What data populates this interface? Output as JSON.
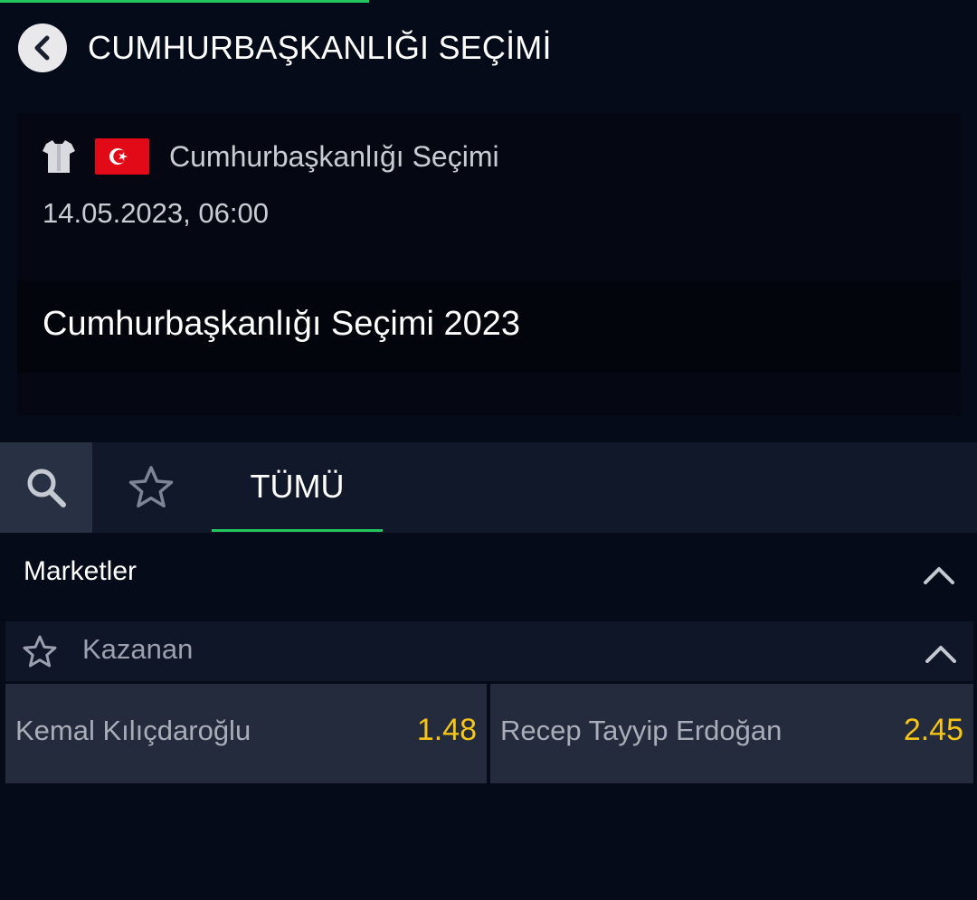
{
  "colors": {
    "accent_green": "#22c55e",
    "odds_yellow": "#f5c518",
    "flag_red": "#e30a17"
  },
  "header": {
    "title": "CUMHURBAŞKANLIĞI SEÇİMİ",
    "back_icon": "chevron-left-icon"
  },
  "event": {
    "sport_icon": "jersey-icon",
    "flag_icon": "turkey-flag-icon",
    "league": "Cumhurbaşkanlığı Seçimi",
    "datetime": "14.05.2023, 06:00",
    "name": "Cumhurbaşkanlığı Seçimi 2023"
  },
  "tabs": {
    "search_icon": "search-icon",
    "favorites_icon": "star-icon",
    "all_label": "TÜMÜ"
  },
  "markets": {
    "title": "Marketler",
    "groups": [
      {
        "name": "Kazanan",
        "selections": [
          {
            "label": "Kemal Kılıçdaroğlu",
            "odds": "1.48"
          },
          {
            "label": "Recep Tayyip Erdoğan",
            "odds": "2.45"
          }
        ]
      }
    ]
  }
}
